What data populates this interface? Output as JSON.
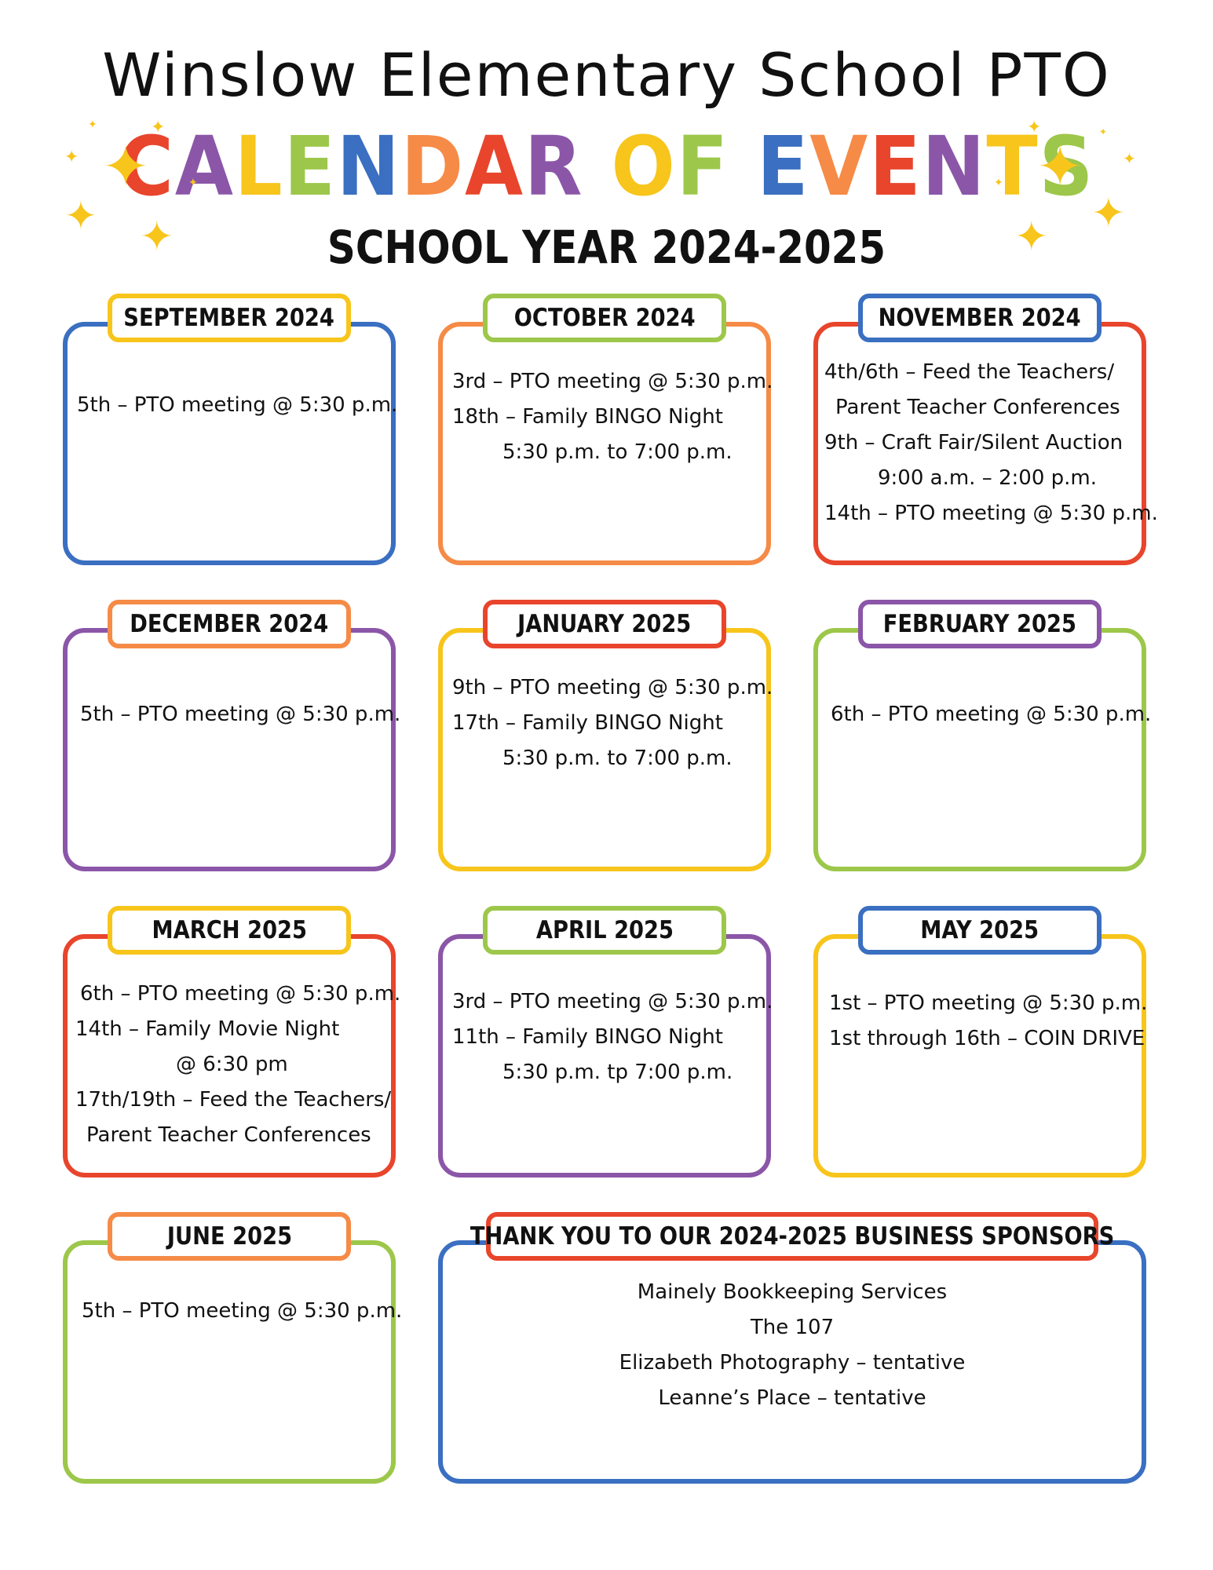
{
  "header": {
    "org_title": "Winslow Elementary School PTO",
    "calendar_title": {
      "letters": [
        {
          "ch": "C",
          "color": "#E8452C"
        },
        {
          "ch": "A",
          "color": "#8B56A8"
        },
        {
          "ch": "L",
          "color": "#F7C51B"
        },
        {
          "ch": "E",
          "color": "#9DC74A"
        },
        {
          "ch": "N",
          "color": "#3A6FC1"
        },
        {
          "ch": "D",
          "color": "#F58B47"
        },
        {
          "ch": "A",
          "color": "#E8452C"
        },
        {
          "ch": "R",
          "color": "#8B56A8"
        },
        {
          "ch": " ",
          "color": "#111111"
        },
        {
          "ch": "O",
          "color": "#F7C51B"
        },
        {
          "ch": "F",
          "color": "#9DC74A"
        },
        {
          "ch": " ",
          "color": "#111111"
        },
        {
          "ch": "E",
          "color": "#3A6FC1"
        },
        {
          "ch": "V",
          "color": "#F58B47"
        },
        {
          "ch": "E",
          "color": "#E8452C"
        },
        {
          "ch": "N",
          "color": "#8B56A8"
        },
        {
          "ch": "T",
          "color": "#F7C51B"
        },
        {
          "ch": "S",
          "color": "#9DC74A"
        }
      ]
    },
    "school_year": "SCHOOL YEAR 2024-2025"
  },
  "colors": {
    "blue": "#3A6FC1",
    "orange": "#F58B47",
    "red": "#E8452C",
    "purple": "#8B56A8",
    "yellow": "#F7C51B",
    "green": "#9DC74A",
    "sparkle": "#F7C51B"
  },
  "months": [
    {
      "title": "SEPTEMBER 2024",
      "box_color": "#3A6FC1",
      "tab_color": "#F7C51B",
      "lines": [
        "5th – PTO meeting @ 5:30 p.m."
      ]
    },
    {
      "title": "OCTOBER 2024",
      "box_color": "#F58B47",
      "tab_color": "#9DC74A",
      "lines": [
        "3rd – PTO meeting @ 5:30 p.m.",
        "18th – Family BINGO Night",
        "5:30 p.m. to 7:00 p.m."
      ]
    },
    {
      "title": "NOVEMBER 2024",
      "box_color": "#E8452C",
      "tab_color": "#3A6FC1",
      "lines": [
        "4th/6th – Feed the Teachers/",
        "Parent Teacher Conferences",
        "9th – Craft Fair/Silent Auction",
        "9:00 a.m. – 2:00 p.m.",
        "14th – PTO meeting @ 5:30 p.m."
      ]
    },
    {
      "title": "DECEMBER 2024",
      "box_color": "#8B56A8",
      "tab_color": "#F58B47",
      "lines": [
        "5th – PTO meeting @ 5:30 p.m."
      ]
    },
    {
      "title": "JANUARY 2025",
      "box_color": "#F7C51B",
      "tab_color": "#E8452C",
      "lines": [
        "9th – PTO meeting @ 5:30 p.m.",
        "17th – Family BINGO Night",
        "5:30 p.m. to 7:00 p.m."
      ]
    },
    {
      "title": "FEBRUARY 2025",
      "box_color": "#9DC74A",
      "tab_color": "#8B56A8",
      "lines": [
        "6th – PTO meeting @ 5:30 p.m."
      ]
    },
    {
      "title": "MARCH 2025",
      "box_color": "#E8452C",
      "tab_color": "#F7C51B",
      "lines": [
        "6th – PTO meeting @ 5:30 p.m.",
        "14th – Family Movie Night",
        "@ 6:30 pm",
        "17th/19th – Feed the Teachers/",
        "Parent Teacher Conferences"
      ]
    },
    {
      "title": "APRIL 2025",
      "box_color": "#8B56A8",
      "tab_color": "#9DC74A",
      "lines": [
        "3rd – PTO meeting @ 5:30 p.m.",
        "11th – Family BINGO Night",
        "5:30 p.m. tp 7:00 p.m."
      ]
    },
    {
      "title": "MAY 2025",
      "box_color": "#F7C51B",
      "tab_color": "#3A6FC1",
      "lines": [
        "1st – PTO meeting @ 5:30 p.m.",
        "1st through 16th – COIN DRIVE"
      ]
    },
    {
      "title": "JUNE 2025",
      "box_color": "#9DC74A",
      "tab_color": "#F58B47",
      "lines": [
        "5th – PTO meeting @ 5:30 p.m."
      ]
    }
  ],
  "sponsors": {
    "title": "THANK YOU TO OUR 2024-2025 BUSINESS SPONSORS",
    "box_color": "#3A6FC1",
    "tab_color": "#E8452C",
    "lines": [
      "Mainely Bookkeeping Services",
      "The 107",
      "Elizabeth Photography – tentative",
      "Leanne’s Place – tentative"
    ]
  }
}
